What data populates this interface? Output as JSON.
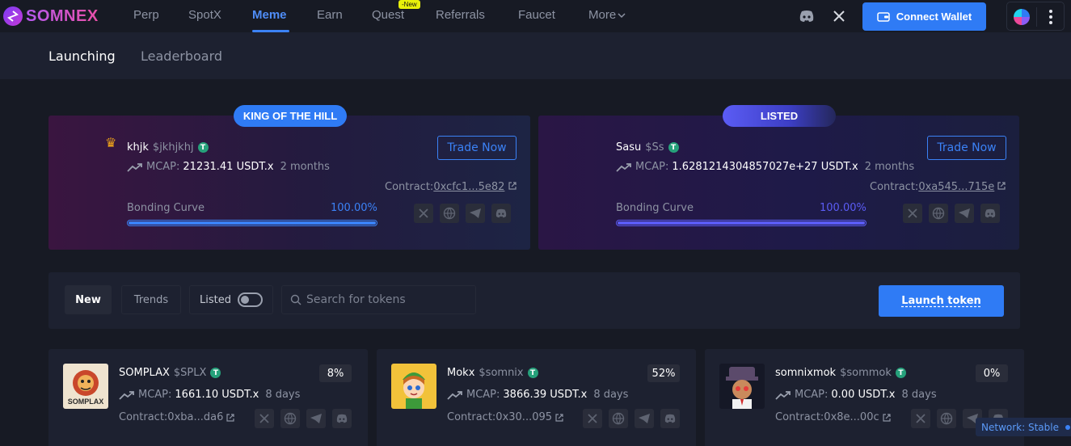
{
  "brand": {
    "name": "SOMNEX"
  },
  "nav": {
    "items": [
      "Perp",
      "SpotX",
      "Meme",
      "Earn",
      "Quest",
      "Referrals",
      "Faucet",
      "More"
    ],
    "active": "Meme",
    "new_badge": "New"
  },
  "header": {
    "connect_wallet": "Connect Wallet"
  },
  "subnav": {
    "items": [
      "Launching",
      "Leaderboard"
    ],
    "active": "Launching"
  },
  "featured": {
    "king": {
      "tag": "KING OF THE HILL",
      "name": "khjk",
      "ticker": "$jkhjkhj",
      "mcap_label": "MCAP:",
      "mcap_value": "21231.41 USDT.x",
      "age": "2 months",
      "trade": "Trade Now",
      "contract_label": "Contract:",
      "contract": "0xcfc1...5e82",
      "bonding_label": "Bonding Curve",
      "bonding_pct": "100.00%",
      "bonding_fraction": 1.0
    },
    "listed": {
      "tag": "LISTED",
      "name": "Sasu",
      "ticker": "$Ss",
      "mcap_label": "MCAP:",
      "mcap_value": "1.6281214304857027e+27 USDT.x",
      "age": "2 months",
      "trade": "Trade Now",
      "contract_label": "Contract:",
      "contract": "0xa545...715e",
      "bonding_label": "Bonding Curve",
      "bonding_pct": "100.00%",
      "bonding_fraction": 1.0
    }
  },
  "filters": {
    "new": "New",
    "trends": "Trends",
    "listed": "Listed",
    "search_placeholder": "Search for tokens",
    "launch": "Launch token"
  },
  "tokens": [
    {
      "name": "SOMPLAX",
      "ticker": "$SPLX",
      "pct": "8%",
      "mcap_label": "MCAP:",
      "mcap": "1661.10 USDT.x",
      "age": "8 days",
      "contract": "Contract:0xba...da6",
      "image_text": "SOMPLAX"
    },
    {
      "name": "Mokx",
      "ticker": "$somnix",
      "pct": "52%",
      "mcap_label": "MCAP:",
      "mcap": "3866.39 USDT.x",
      "age": "8 days",
      "contract": "Contract:0x30...095"
    },
    {
      "name": "somnixmok",
      "ticker": "$sommok",
      "pct": "0%",
      "mcap_label": "MCAP:",
      "mcap": "0.00 USDT.x",
      "age": "8 days",
      "contract": "Contract:0x8e...00c"
    }
  ],
  "status": {
    "network": "Network: Stable"
  }
}
